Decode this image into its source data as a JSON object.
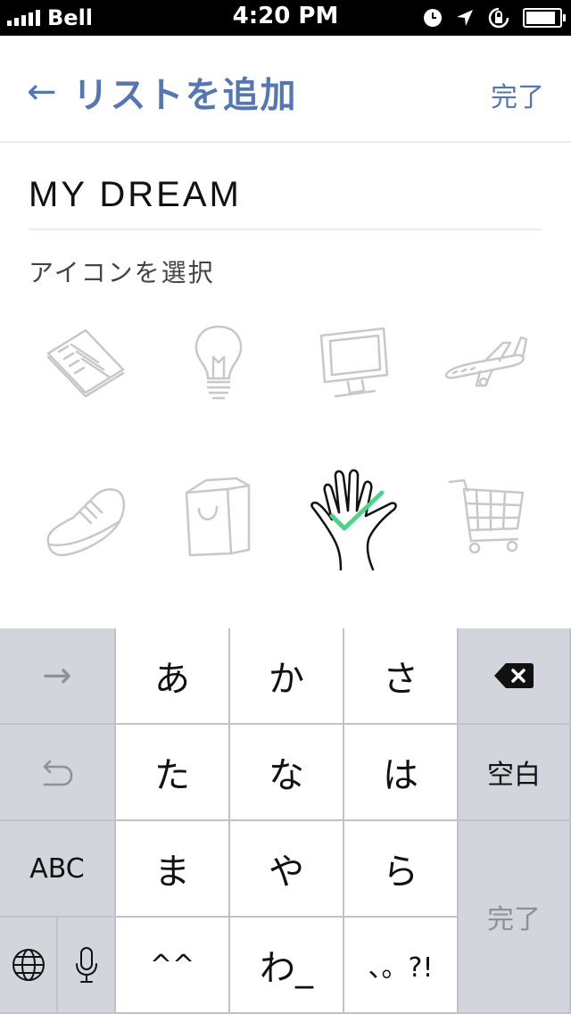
{
  "status_bar": {
    "carrier": "Bell",
    "time": "4:20 PM",
    "icons": [
      "clock-icon",
      "location-arrow-icon",
      "rotation-lock-icon",
      "battery-icon"
    ]
  },
  "nav": {
    "back_icon": "←",
    "title": "リストを追加",
    "done": "完了"
  },
  "list_name": {
    "value": "MY DREAM"
  },
  "icon_section": {
    "label": "アイコンを選択"
  },
  "icons": [
    {
      "name": "notepad",
      "selected": false
    },
    {
      "name": "light-bulb",
      "selected": false
    },
    {
      "name": "computer-monitor",
      "selected": false
    },
    {
      "name": "airplane",
      "selected": false
    },
    {
      "name": "sneaker",
      "selected": false
    },
    {
      "name": "shopping-bag",
      "selected": false
    },
    {
      "name": "hand-check",
      "selected": true
    },
    {
      "name": "shopping-cart",
      "selected": false
    }
  ],
  "colors": {
    "accent": "#5477b3",
    "check": "#4cd38a",
    "icon_muted": "#c8c8c8",
    "key_dark": "#d2d5db"
  },
  "keyboard": {
    "next": "→",
    "undo": "⤺",
    "abc": "ABC",
    "globe": "globe-icon",
    "mic": "microphone-icon",
    "row1": [
      "あ",
      "か",
      "さ"
    ],
    "row2": [
      "た",
      "な",
      "は"
    ],
    "row3": [
      "ま",
      "や",
      "ら"
    ],
    "row4": [
      "^^",
      "わ_",
      "、。?!"
    ],
    "delete": "delete-icon",
    "space": "空白",
    "enter": "完了"
  }
}
